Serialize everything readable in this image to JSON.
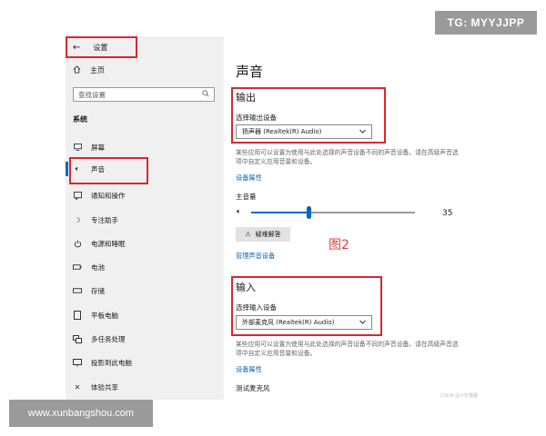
{
  "watermark_top": "TG: MYYJJPP",
  "watermark_bottom": "www.xunbangshou.com",
  "csdn_mark": "CSDN @小花猫猫",
  "figure_label": "图2",
  "sidebar": {
    "back_label": "设置",
    "home_label": "主页",
    "search_placeholder": "查找设置",
    "section_label": "系统",
    "items": [
      {
        "label": "屏幕",
        "icon": "monitor-icon"
      },
      {
        "label": "声音",
        "icon": "speaker-icon",
        "active": true
      },
      {
        "label": "通知和操作",
        "icon": "notification-icon"
      },
      {
        "label": "专注助手",
        "icon": "moon-icon"
      },
      {
        "label": "电源和睡眠",
        "icon": "power-icon"
      },
      {
        "label": "电池",
        "icon": "battery-icon"
      },
      {
        "label": "存储",
        "icon": "storage-icon"
      },
      {
        "label": "平板电脑",
        "icon": "tablet-icon"
      },
      {
        "label": "多任务处理",
        "icon": "multitask-icon"
      },
      {
        "label": "投影到此电脑",
        "icon": "projection-icon"
      },
      {
        "label": "体验共享",
        "icon": "share-icon"
      }
    ]
  },
  "main": {
    "title": "声音",
    "output": {
      "heading": "输出",
      "select_label": "选择输出设备",
      "selected_device": "扬声器 (Realtek(R) Audio)",
      "description": "某些应用可以设置为使用与此处选择的声音设备不同的声音设备。请在高级声音选项中自定义应用音量和设备。",
      "device_properties_link": "设备属性",
      "master_volume_label": "主音量",
      "volume_value": "35",
      "volume_level": 0.35,
      "troubleshoot_label": "疑难解答",
      "manage_devices_link": "管理声音设备"
    },
    "input": {
      "heading": "输入",
      "select_label": "选择输入设备",
      "selected_device": "外部麦克风 (Realtek(R) Audio)",
      "description": "某些应用可以设置为使用与此处选择的声音设备不同的声音设备。请在高级声音选项中自定义应用音量和设备。",
      "device_properties_link": "设备属性",
      "test_mic_label": "测试麦克风"
    }
  },
  "colors": {
    "accent": "#0067c0",
    "highlight_box": "#d8282f",
    "sidebar_bg": "#f0f0f0"
  }
}
